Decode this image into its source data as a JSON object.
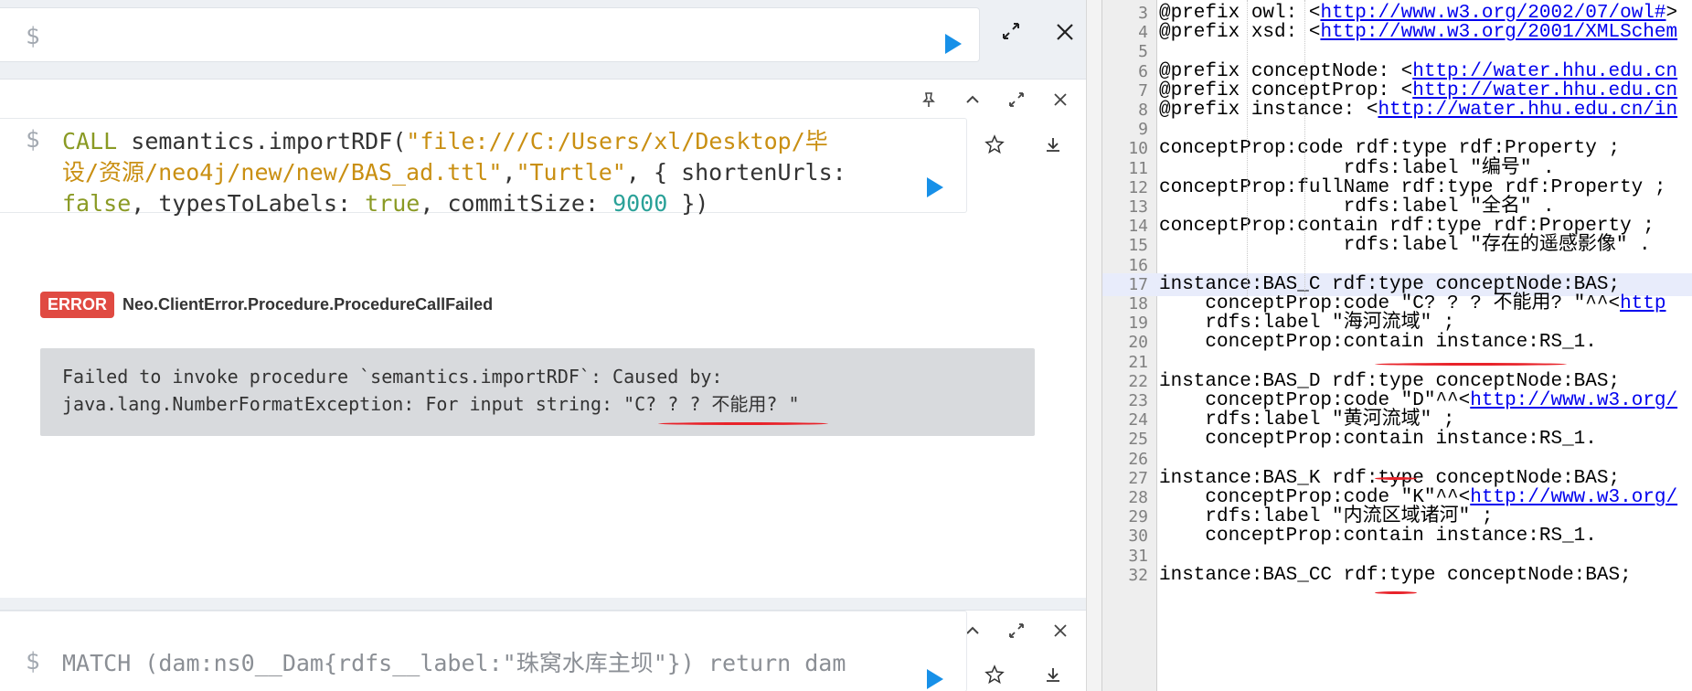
{
  "neo4j": {
    "editor": {
      "prompt": "$"
    },
    "frames": [
      {
        "prompt": "$",
        "query_parts": [
          {
            "t": "kw",
            "v": "CALL"
          },
          {
            "t": "plain",
            "v": " semantics.importRDF("
          },
          {
            "t": "str",
            "v": "\"file:///C:/Users/xl/Desktop/毕\n设/资源/neo4j/new/new/BAS_ad.ttl\""
          },
          {
            "t": "plain",
            "v": ","
          },
          {
            "t": "str",
            "v": "\"Turtle\""
          },
          {
            "t": "plain",
            "v": ", { shortenUrls:\n"
          },
          {
            "t": "kw",
            "v": "false"
          },
          {
            "t": "plain",
            "v": ", typesToLabels: "
          },
          {
            "t": "kw",
            "v": "true"
          },
          {
            "t": "plain",
            "v": ", commitSize: "
          },
          {
            "t": "num",
            "v": "9000"
          },
          {
            "t": "plain",
            "v": " })"
          }
        ],
        "error_badge": "ERROR",
        "error_code": "Neo.ClientError.Procedure.ProcedureCallFailed",
        "error_message": "Failed to invoke procedure `semantics.importRDF`: Caused by:\njava.lang.NumberFormatException: For input string: \"C? ? ? 不能用? \""
      },
      {
        "prompt": "$",
        "query": "MATCH (dam:ns0__Dam{rdfs__label:\"珠窝水库主坝\"}) return dam"
      }
    ]
  },
  "code_editor": {
    "lines": [
      {
        "n": "3",
        "parts": [
          [
            "@prefix owl: <",
            ""
          ],
          [
            "http://www.w3.org/2002/07/owl#",
            "u"
          ],
          [
            ">",
            ""
          ]
        ]
      },
      {
        "n": "4",
        "parts": [
          [
            "@prefix xsd: <",
            ""
          ],
          [
            "http://www.w3.org/2001/XMLSchem",
            "u"
          ]
        ]
      },
      {
        "n": "5",
        "parts": []
      },
      {
        "n": "6",
        "parts": [
          [
            "@prefix conceptNode: <",
            ""
          ],
          [
            "http://water.hhu.edu.cn",
            "u"
          ]
        ]
      },
      {
        "n": "7",
        "parts": [
          [
            "@prefix conceptProp: <",
            ""
          ],
          [
            "http://water.hhu.edu.cn",
            "u"
          ]
        ]
      },
      {
        "n": "8",
        "parts": [
          [
            "@prefix instance: <",
            ""
          ],
          [
            "http://water.hhu.edu.cn/in",
            "u"
          ]
        ]
      },
      {
        "n": "9",
        "parts": []
      },
      {
        "n": "10",
        "parts": [
          [
            "conceptProp:code rdf:type rdf:Property ;",
            ""
          ]
        ]
      },
      {
        "n": "11",
        "parts": [
          [
            "                rdfs:label \"编号\" .",
            ""
          ]
        ]
      },
      {
        "n": "12",
        "parts": [
          [
            "conceptProp:fullName rdf:type rdf:Property ;",
            ""
          ]
        ]
      },
      {
        "n": "13",
        "parts": [
          [
            "                rdfs:label \"全名\" .",
            ""
          ]
        ]
      },
      {
        "n": "14",
        "parts": [
          [
            "conceptProp:contain rdf:type rdf:Property ;",
            ""
          ]
        ]
      },
      {
        "n": "15",
        "parts": [
          [
            "                rdfs:label \"存在的遥感影像\" .",
            ""
          ]
        ]
      },
      {
        "n": "16",
        "parts": []
      },
      {
        "n": "17",
        "hl": true,
        "parts": [
          [
            "instance:BAS_C rdf:type conceptNode:BAS;",
            ""
          ]
        ]
      },
      {
        "n": "18",
        "parts": [
          [
            "    conceptProp:code \"C? ? ? 不能用? \"^^<",
            ""
          ],
          [
            "http",
            "u"
          ]
        ]
      },
      {
        "n": "19",
        "parts": [
          [
            "    rdfs:label \"海河流域\" ;",
            ""
          ]
        ]
      },
      {
        "n": "20",
        "parts": [
          [
            "    conceptProp:contain instance:RS_1.",
            ""
          ]
        ]
      },
      {
        "n": "21",
        "parts": []
      },
      {
        "n": "22",
        "parts": [
          [
            "instance:BAS_D rdf:type conceptNode:BAS;",
            ""
          ]
        ]
      },
      {
        "n": "23",
        "parts": [
          [
            "    conceptProp:code \"D\"^^<",
            ""
          ],
          [
            "http://www.w3.org/",
            "u"
          ]
        ]
      },
      {
        "n": "24",
        "parts": [
          [
            "    rdfs:label \"黄河流域\" ;",
            ""
          ]
        ]
      },
      {
        "n": "25",
        "parts": [
          [
            "    conceptProp:contain instance:RS_1.",
            ""
          ]
        ]
      },
      {
        "n": "26",
        "parts": []
      },
      {
        "n": "27",
        "parts": [
          [
            "instance:BAS_K rdf:type conceptNode:BAS;",
            ""
          ]
        ]
      },
      {
        "n": "28",
        "parts": [
          [
            "    conceptProp:code \"K\"^^<",
            ""
          ],
          [
            "http://www.w3.org/",
            "u"
          ]
        ]
      },
      {
        "n": "29",
        "parts": [
          [
            "    rdfs:label \"内流区域诸河\" ;",
            ""
          ]
        ]
      },
      {
        "n": "30",
        "parts": [
          [
            "    conceptProp:contain instance:RS_1.",
            ""
          ]
        ]
      },
      {
        "n": "31",
        "parts": []
      },
      {
        "n": "32",
        "parts": [
          [
            "instance:BAS_CC rdf:type conceptNode:BAS;",
            ""
          ]
        ]
      }
    ]
  },
  "colors": {
    "keyword": "#8a9a24",
    "string": "#c98f12",
    "number": "#2aa198",
    "error": "#e04a42",
    "play": "#1790e8",
    "annotation": "#e8232a"
  },
  "icons": [
    "play-icon",
    "expand-icon",
    "close-icon",
    "pin-icon",
    "chevron-up-icon",
    "star-icon",
    "download-icon"
  ]
}
